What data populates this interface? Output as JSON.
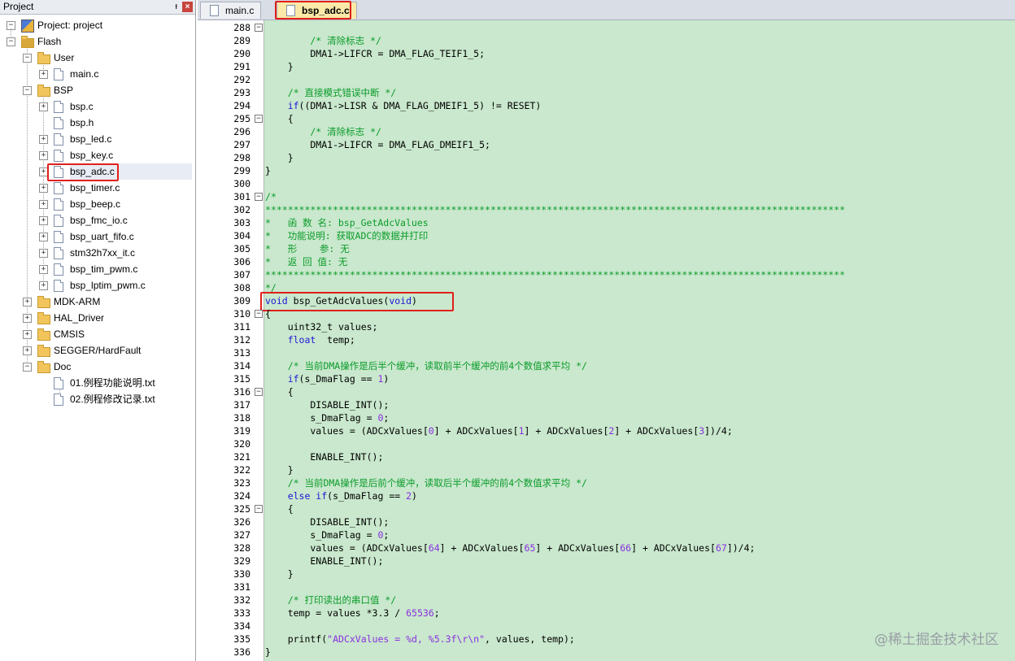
{
  "project_panel": {
    "title": "Project",
    "pin_glyph": "ᵼ",
    "close_glyph": "×",
    "root": "Project: project",
    "tree": [
      {
        "label": "Flash",
        "kind": "folder-root",
        "indent": 1,
        "expander": "−"
      },
      {
        "label": "User",
        "kind": "folder",
        "indent": 2,
        "expander": "−"
      },
      {
        "label": "main.c",
        "kind": "file",
        "indent": 3,
        "expander": "+"
      },
      {
        "label": "BSP",
        "kind": "folder",
        "indent": 2,
        "expander": "−"
      },
      {
        "label": "bsp.c",
        "kind": "file",
        "indent": 3,
        "expander": "+"
      },
      {
        "label": "bsp.h",
        "kind": "file",
        "indent": 3,
        "expander": ""
      },
      {
        "label": "bsp_led.c",
        "kind": "file",
        "indent": 3,
        "expander": "+"
      },
      {
        "label": "bsp_key.c",
        "kind": "file",
        "indent": 3,
        "expander": "+"
      },
      {
        "label": "bsp_adc.c",
        "kind": "file",
        "indent": 3,
        "expander": "+",
        "selected": true
      },
      {
        "label": "bsp_timer.c",
        "kind": "file",
        "indent": 3,
        "expander": "+"
      },
      {
        "label": "bsp_beep.c",
        "kind": "file",
        "indent": 3,
        "expander": "+"
      },
      {
        "label": "bsp_fmc_io.c",
        "kind": "file",
        "indent": 3,
        "expander": "+"
      },
      {
        "label": "bsp_uart_fifo.c",
        "kind": "file",
        "indent": 3,
        "expander": "+"
      },
      {
        "label": "stm32h7xx_it.c",
        "kind": "file",
        "indent": 3,
        "expander": "+"
      },
      {
        "label": "bsp_tim_pwm.c",
        "kind": "file",
        "indent": 3,
        "expander": "+"
      },
      {
        "label": "bsp_lptim_pwm.c",
        "kind": "file",
        "indent": 3,
        "expander": "+"
      },
      {
        "label": "MDK-ARM",
        "kind": "folder",
        "indent": 2,
        "expander": "+"
      },
      {
        "label": "HAL_Driver",
        "kind": "folder",
        "indent": 2,
        "expander": "+"
      },
      {
        "label": "CMSIS",
        "kind": "folder",
        "indent": 2,
        "expander": "+"
      },
      {
        "label": "SEGGER/HardFault",
        "kind": "folder",
        "indent": 2,
        "expander": "+"
      },
      {
        "label": "Doc",
        "kind": "folder",
        "indent": 2,
        "expander": "−"
      },
      {
        "label": "01.例程功能说明.txt",
        "kind": "file",
        "indent": 3,
        "expander": ""
      },
      {
        "label": "02.例程修改记录.txt",
        "kind": "file",
        "indent": 3,
        "expander": ""
      }
    ]
  },
  "tabs": [
    {
      "label": "main.c",
      "active": false
    },
    {
      "label": "bsp_adc.c",
      "active": true
    }
  ],
  "editor": {
    "lines": [
      {
        "n": "288",
        "fold": "−",
        "t": [
          [
            "",
            ""
          ],
          " {"
        ]
      },
      {
        "n": "289",
        "fold": "",
        "t": [
          [
            "c-com",
            "        /* 清除标志 */"
          ]
        ]
      },
      {
        "n": "290",
        "fold": "",
        "t": [
          [
            "",
            "        DMA1->LIFCR = DMA_FLAG_TEIF1_5;"
          ]
        ]
      },
      {
        "n": "291",
        "fold": "",
        "t": [
          [
            "",
            "    }"
          ]
        ]
      },
      {
        "n": "292",
        "fold": "",
        "t": [
          [
            "",
            ""
          ]
        ]
      },
      {
        "n": "293",
        "fold": "",
        "t": [
          [
            "c-com",
            "    /* 直接模式错误中断 */"
          ]
        ]
      },
      {
        "n": "294",
        "fold": "",
        "t": [
          [
            "c-kw",
            "    if"
          ],
          [
            "",
            "((DMA1->LISR & DMA_FLAG_DMEIF1_5) != RESET)"
          ]
        ]
      },
      {
        "n": "295",
        "fold": "−",
        "t": [
          [
            "",
            "    {"
          ]
        ]
      },
      {
        "n": "296",
        "fold": "",
        "t": [
          [
            "c-com",
            "        /* 清除标志 */"
          ]
        ]
      },
      {
        "n": "297",
        "fold": "",
        "t": [
          [
            "",
            "        DMA1->LIFCR = DMA_FLAG_DMEIF1_5;"
          ]
        ]
      },
      {
        "n": "298",
        "fold": "",
        "t": [
          [
            "",
            "    }"
          ]
        ]
      },
      {
        "n": "299",
        "fold": "",
        "t": [
          [
            "",
            "}"
          ]
        ]
      },
      {
        "n": "300",
        "fold": "",
        "t": [
          [
            "",
            ""
          ]
        ]
      },
      {
        "n": "301",
        "fold": "−",
        "t": [
          [
            "c-com",
            "/*"
          ]
        ]
      },
      {
        "n": "302",
        "fold": "",
        "t": [
          [
            "c-com",
            "*******************************************************************************************************"
          ]
        ]
      },
      {
        "n": "303",
        "fold": "",
        "t": [
          [
            "c-com",
            "*   函 数 名: bsp_GetAdcValues"
          ]
        ]
      },
      {
        "n": "304",
        "fold": "",
        "t": [
          [
            "c-com",
            "*   功能说明: 获取ADC的数据并打印"
          ]
        ]
      },
      {
        "n": "305",
        "fold": "",
        "t": [
          [
            "c-com",
            "*   形    参: 无"
          ]
        ]
      },
      {
        "n": "306",
        "fold": "",
        "t": [
          [
            "c-com",
            "*   返 回 值: 无"
          ]
        ]
      },
      {
        "n": "307",
        "fold": "",
        "t": [
          [
            "c-com",
            "*******************************************************************************************************"
          ]
        ]
      },
      {
        "n": "308",
        "fold": "",
        "t": [
          [
            "c-com",
            "*/"
          ]
        ]
      },
      {
        "n": "309",
        "fold": "",
        "t": [
          [
            "c-kw",
            "void"
          ],
          [
            "",
            " bsp_GetAdcValues("
          ],
          [
            "c-kw",
            "void"
          ],
          [
            "",
            ")"
          ]
        ]
      },
      {
        "n": "310",
        "fold": "−",
        "t": [
          [
            "",
            "{"
          ]
        ]
      },
      {
        "n": "311",
        "fold": "",
        "t": [
          [
            "",
            "    uint32_t values;"
          ]
        ]
      },
      {
        "n": "312",
        "fold": "",
        "t": [
          [
            "c-kw",
            "    float"
          ],
          [
            "",
            "  temp;"
          ]
        ]
      },
      {
        "n": "313",
        "fold": "",
        "t": [
          [
            "",
            ""
          ]
        ]
      },
      {
        "n": "314",
        "fold": "",
        "t": [
          [
            "c-com",
            "    /* 当前DMA操作是后半个缓冲，读取前半个缓冲的前4个数值求平均 */"
          ]
        ]
      },
      {
        "n": "315",
        "fold": "",
        "t": [
          [
            "c-kw",
            "    if"
          ],
          [
            "",
            "(s_DmaFlag == "
          ],
          [
            "c-num",
            "1"
          ],
          [
            "",
            ")"
          ]
        ]
      },
      {
        "n": "316",
        "fold": "−",
        "t": [
          [
            "",
            "    {"
          ]
        ]
      },
      {
        "n": "317",
        "fold": "",
        "t": [
          [
            "",
            "        DISABLE_INT();"
          ]
        ]
      },
      {
        "n": "318",
        "fold": "",
        "t": [
          [
            "",
            "        s_DmaFlag = "
          ],
          [
            "c-num",
            "0"
          ],
          [
            "",
            ";"
          ]
        ]
      },
      {
        "n": "319",
        "fold": "",
        "t": [
          [
            "",
            "        values = (ADCxValues["
          ],
          [
            "c-num",
            "0"
          ],
          [
            "",
            "] + ADCxValues["
          ],
          [
            "c-num",
            "1"
          ],
          [
            "",
            "] + ADCxValues["
          ],
          [
            "c-num",
            "2"
          ],
          [
            "",
            "] + ADCxValues["
          ],
          [
            "c-num",
            "3"
          ],
          [
            "",
            "])/4;"
          ]
        ]
      },
      {
        "n": "320",
        "fold": "",
        "t": [
          [
            "",
            ""
          ]
        ]
      },
      {
        "n": "321",
        "fold": "",
        "t": [
          [
            "",
            "        ENABLE_INT();"
          ]
        ]
      },
      {
        "n": "322",
        "fold": "",
        "t": [
          [
            "",
            "    }"
          ]
        ]
      },
      {
        "n": "323",
        "fold": "",
        "t": [
          [
            "c-com",
            "    /* 当前DMA操作是后前个缓冲，读取后半个缓冲的前4个数值求平均 */"
          ]
        ]
      },
      {
        "n": "324",
        "fold": "",
        "t": [
          [
            "c-kw",
            "    else if"
          ],
          [
            "",
            "(s_DmaFlag == "
          ],
          [
            "c-num",
            "2"
          ],
          [
            "",
            ")"
          ]
        ]
      },
      {
        "n": "325",
        "fold": "−",
        "t": [
          [
            "",
            "    {"
          ]
        ]
      },
      {
        "n": "326",
        "fold": "",
        "t": [
          [
            "",
            "        DISABLE_INT();"
          ]
        ]
      },
      {
        "n": "327",
        "fold": "",
        "t": [
          [
            "",
            "        s_DmaFlag = "
          ],
          [
            "c-num",
            "0"
          ],
          [
            "",
            ";"
          ]
        ]
      },
      {
        "n": "328",
        "fold": "",
        "t": [
          [
            "",
            "        values = (ADCxValues["
          ],
          [
            "c-num",
            "64"
          ],
          [
            "",
            "] + ADCxValues["
          ],
          [
            "c-num",
            "65"
          ],
          [
            "",
            "] + ADCxValues["
          ],
          [
            "c-num",
            "66"
          ],
          [
            "",
            "] + ADCxValues["
          ],
          [
            "c-num",
            "67"
          ],
          [
            "",
            "])/4;"
          ]
        ]
      },
      {
        "n": "329",
        "fold": "",
        "t": [
          [
            "",
            "        ENABLE_INT();"
          ]
        ]
      },
      {
        "n": "330",
        "fold": "",
        "t": [
          [
            "",
            "    }"
          ]
        ]
      },
      {
        "n": "331",
        "fold": "",
        "t": [
          [
            "",
            ""
          ]
        ]
      },
      {
        "n": "332",
        "fold": "",
        "t": [
          [
            "c-com",
            "    /* 打印读出的串口值 */"
          ]
        ]
      },
      {
        "n": "333",
        "fold": "",
        "t": [
          [
            "",
            "    temp = values *3.3 / "
          ],
          [
            "c-num",
            "65536"
          ],
          [
            "",
            ";"
          ]
        ]
      },
      {
        "n": "334",
        "fold": "",
        "t": [
          [
            "",
            ""
          ]
        ]
      },
      {
        "n": "335",
        "fold": "",
        "t": [
          [
            "",
            "    printf("
          ],
          [
            "c-str",
            "\"ADCxValues = %d, %5.3f\\r\\n\""
          ],
          [
            "",
            ", values, temp);"
          ]
        ]
      },
      {
        "n": "336",
        "fold": "",
        "t": [
          [
            "",
            "}"
          ]
        ]
      }
    ]
  },
  "watermark": "@稀土掘金技术社区",
  "colors": {
    "highlight_box": "#e0201c",
    "editor_bg": "#c9e8cd",
    "comment": "#0b9b2a",
    "keyword": "#1c17d6"
  }
}
